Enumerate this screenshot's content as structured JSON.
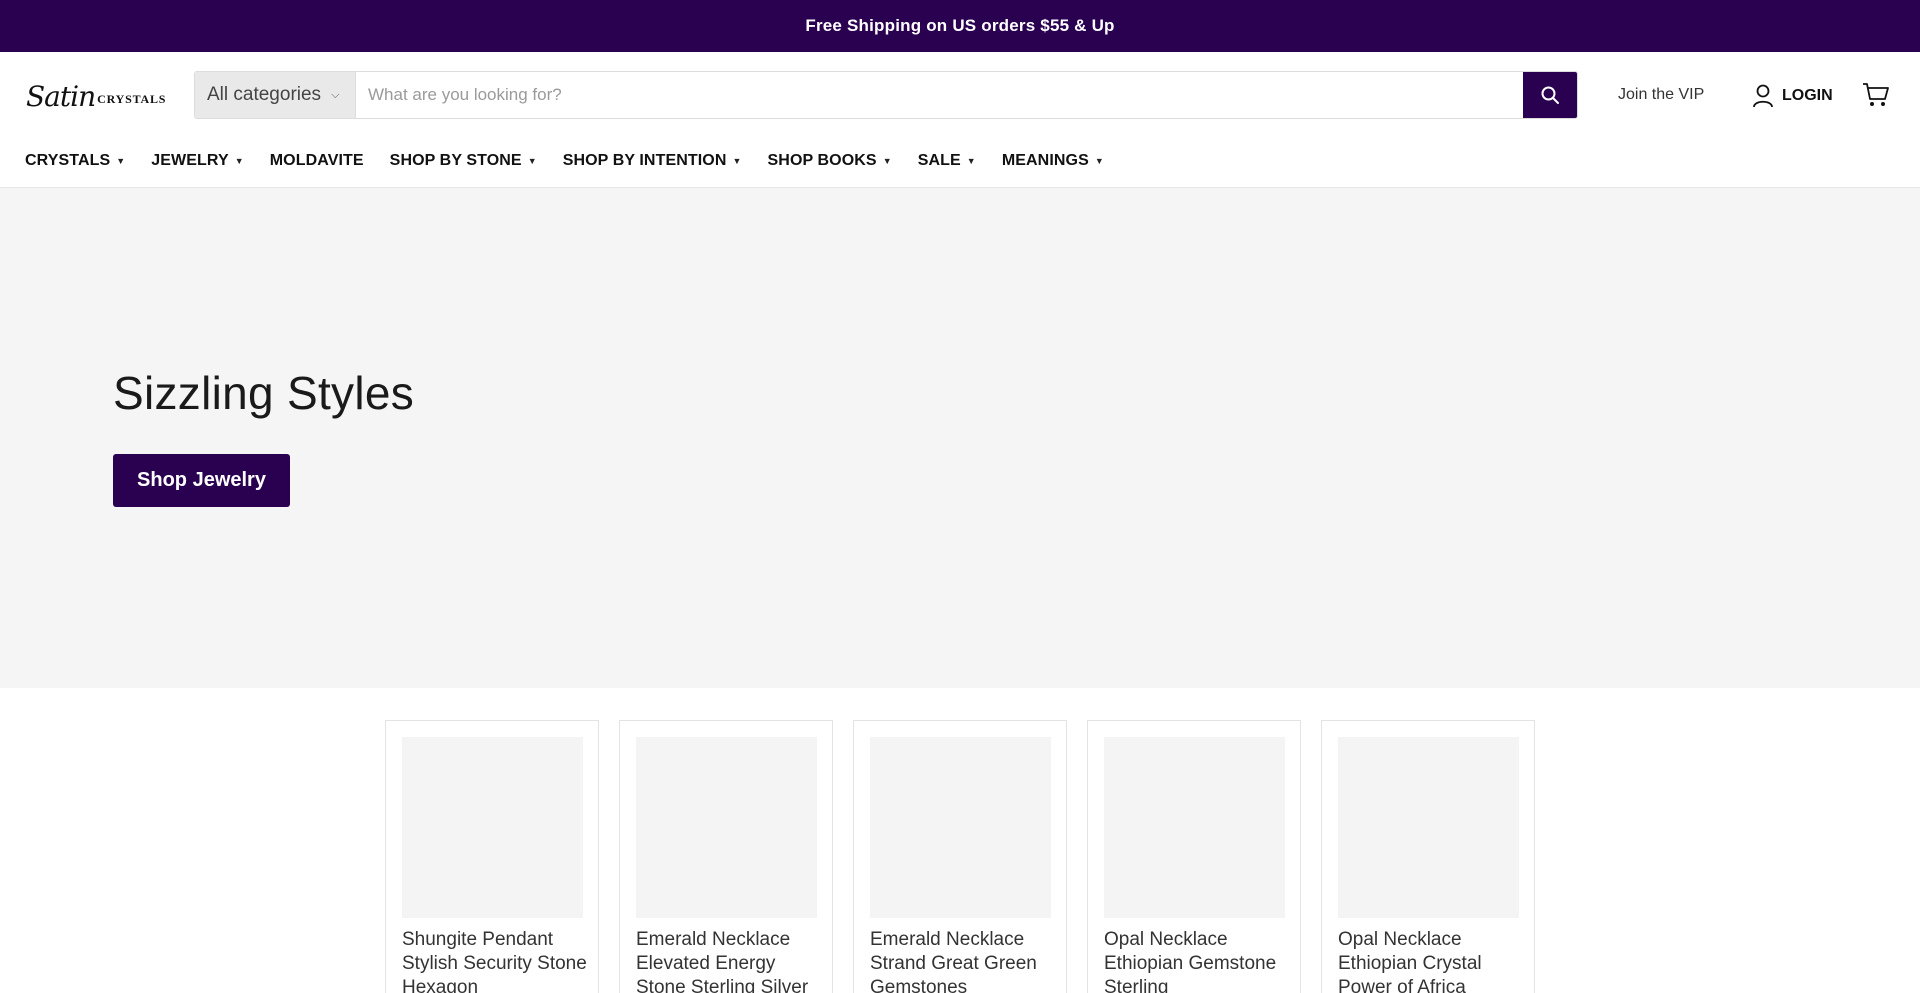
{
  "announcement": {
    "text": "Free Shipping on US orders $55 & Up"
  },
  "logo": {
    "script": "Satin",
    "caps": "CRYSTALS"
  },
  "search": {
    "category_label": "All categories",
    "placeholder": "What are you looking for?",
    "value": ""
  },
  "header_links": {
    "vip_label": "Join the VIP",
    "login_label": "LOGIN"
  },
  "nav": {
    "items": [
      {
        "label": "CRYSTALS",
        "dropdown": true
      },
      {
        "label": "JEWELRY",
        "dropdown": true
      },
      {
        "label": "MOLDAVITE",
        "dropdown": false
      },
      {
        "label": "SHOP BY STONE",
        "dropdown": true
      },
      {
        "label": "SHOP BY INTENTION",
        "dropdown": true
      },
      {
        "label": "SHOP BOOKS",
        "dropdown": true
      },
      {
        "label": "SALE",
        "dropdown": true
      },
      {
        "label": "MEANINGS",
        "dropdown": true
      }
    ]
  },
  "hero": {
    "title": "Sizzling Styles",
    "button_label": "Shop Jewelry"
  },
  "products": [
    {
      "title": "Shungite Pendant Stylish Security Stone Hexagon"
    },
    {
      "title": "Emerald Necklace Elevated Energy Stone Sterling Silver"
    },
    {
      "title": "Emerald Necklace Strand Great Green Gemstones"
    },
    {
      "title": "Opal Necklace Ethiopian Gemstone Sterling"
    },
    {
      "title": "Opal Necklace Ethiopian Crystal Power of Africa"
    }
  ],
  "colors": {
    "brand": "#2a0050",
    "hero_bg": "#f5f5f5"
  }
}
